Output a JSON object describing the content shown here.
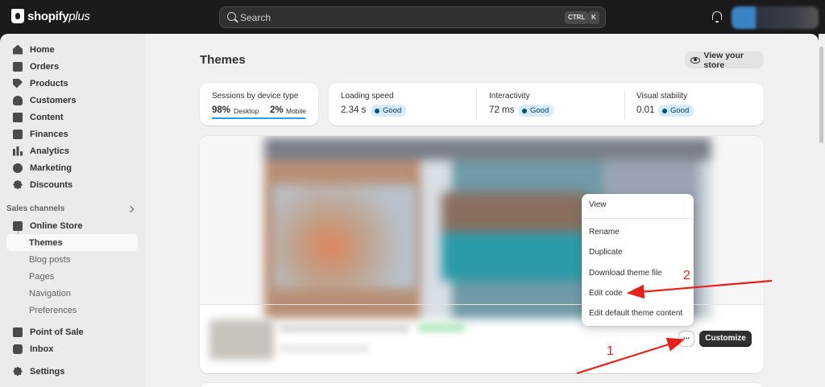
{
  "topbar": {
    "logo_text": "shopify",
    "logo_plus": "plus",
    "search_placeholder": "Search",
    "shortcut_ctrl": "CTRL",
    "shortcut_key": "K"
  },
  "sidebar": {
    "items": [
      {
        "label": "Home",
        "icon": "home-icon"
      },
      {
        "label": "Orders",
        "icon": "orders-icon"
      },
      {
        "label": "Products",
        "icon": "tag-icon"
      },
      {
        "label": "Customers",
        "icon": "person-icon"
      },
      {
        "label": "Content",
        "icon": "content-icon"
      },
      {
        "label": "Finances",
        "icon": "bank-icon"
      },
      {
        "label": "Analytics",
        "icon": "bar-chart-icon"
      },
      {
        "label": "Marketing",
        "icon": "target-icon"
      },
      {
        "label": "Discounts",
        "icon": "discount-icon"
      }
    ],
    "sales_channels_label": "Sales channels",
    "online_store": "Online Store",
    "online_store_sub": [
      "Themes",
      "Blog posts",
      "Pages",
      "Navigation",
      "Preferences"
    ],
    "point_of_sale": "Point of Sale",
    "inbox": "Inbox",
    "settings": "Settings"
  },
  "main": {
    "title": "Themes",
    "view_store_label": "View your store",
    "sessions": {
      "title": "Sessions by device type",
      "desktop_pct": "98%",
      "desktop_label": "Desktop",
      "mobile_pct": "2%",
      "mobile_label": "Mobile",
      "desktop_fraction": 0.98
    },
    "metrics": [
      {
        "title": "Loading speed",
        "value": "2.34 s",
        "status": "Good"
      },
      {
        "title": "Interactivity",
        "value": "72 ms",
        "status": "Good"
      },
      {
        "title": "Visual stability",
        "value": "0.01",
        "status": "Good"
      }
    ],
    "more_label": "...",
    "customize_label": "Customize",
    "menu": [
      "View",
      "Rename",
      "Duplicate",
      "Download theme file",
      "Edit code",
      "Edit default theme content"
    ]
  },
  "annotations": {
    "step1": "1",
    "step2": "2"
  },
  "colors": {
    "accent_red": "#e8201a",
    "badge_bg": "#d5ebff",
    "progress_blue": "#2b9ae0"
  }
}
